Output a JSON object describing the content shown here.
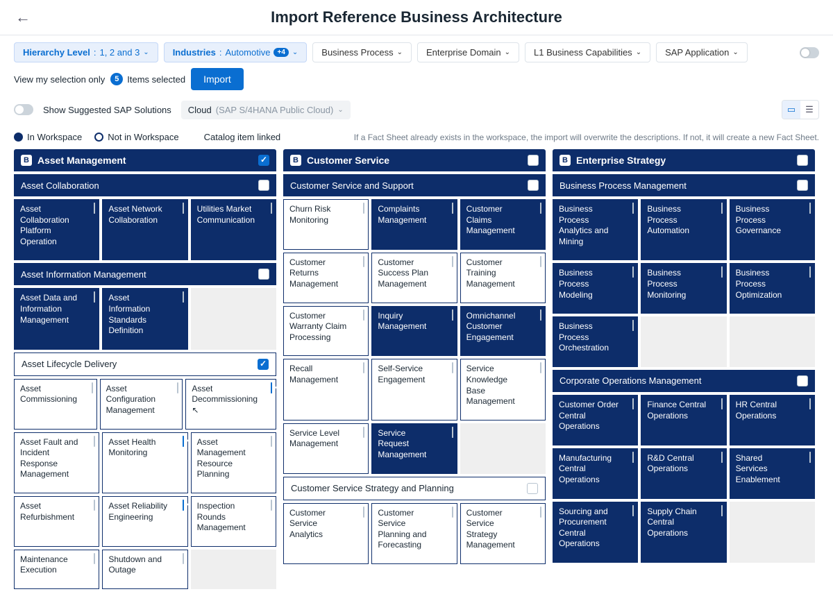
{
  "title": "Import Reference Business Architecture",
  "filters": {
    "hierarchy": {
      "label": "Hierarchy Level",
      "value": "1, 2 and 3"
    },
    "industries": {
      "label": "Industries",
      "value": "Automotive",
      "count": "+4"
    },
    "bp": "Business Process",
    "ed": "Enterprise Domain",
    "l1": "L1 Business Capabilities",
    "sap": "SAP Application",
    "viewSel": "View my selection only",
    "itemsSelected": "Items selected",
    "itemsCount": "5",
    "importBtn": "Import"
  },
  "subbar": {
    "suggest": "Show Suggested SAP Solutions",
    "cloudLabel": "Cloud",
    "cloudVal": "(SAP S/4HANA Public Cloud)"
  },
  "legend": {
    "inWs": "In Workspace",
    "notWs": "Not in Workspace",
    "catalog": "Catalog item linked",
    "hint": "If a Fact Sheet already exists in the workspace, the import will overwrite the descriptions. If not, it will create a new Fact Sheet."
  },
  "cols": [
    {
      "title": "Asset Management",
      "checked": true,
      "groups": [
        {
          "title": "Asset Collaboration",
          "dark": true,
          "items": [
            {
              "t": "Asset Collaboration Platform Operation",
              "dark": true
            },
            {
              "t": "Asset Network Collaboration",
              "dark": true
            },
            {
              "t": "Utilities Market Communication",
              "dark": true
            }
          ]
        },
        {
          "title": "Asset Information Management",
          "dark": true,
          "items": [
            {
              "t": "Asset Data and Information Management",
              "dark": true
            },
            {
              "t": "Asset Information Standards Definition",
              "dark": true
            },
            {
              "t": "",
              "placeholder": true
            }
          ]
        },
        {
          "title": "Asset Lifecycle Delivery",
          "dark": false,
          "checked": true,
          "items": [
            {
              "t": "Asset Commissioning"
            },
            {
              "t": "Asset Configuration Management"
            },
            {
              "t": "Asset Decommissioning",
              "checked": true,
              "cursor": true
            },
            {
              "t": "Asset Fault and Incident Response Management"
            },
            {
              "t": "Asset Health Monitoring",
              "checked": true
            },
            {
              "t": "Asset Management Resource Planning"
            },
            {
              "t": "Asset Refurbishment"
            },
            {
              "t": "Asset Reliability Engineering",
              "checked": true
            },
            {
              "t": "Inspection Rounds Management"
            },
            {
              "t": "Maintenance Execution",
              "nolink": true
            },
            {
              "t": "Shutdown and Outage",
              "nolink": true
            },
            {
              "t": "",
              "placeholder": true,
              "nolink": true
            }
          ]
        }
      ]
    },
    {
      "title": "Customer Service",
      "groups": [
        {
          "title": "Customer Service and Support",
          "dark": true,
          "items": [
            {
              "t": "Churn Risk Monitoring"
            },
            {
              "t": "Complaints Management",
              "dark": true
            },
            {
              "t": "Customer Claims Management",
              "dark": true
            },
            {
              "t": "Customer Returns Management"
            },
            {
              "t": "Customer Success Plan Management"
            },
            {
              "t": "Customer Training Management"
            },
            {
              "t": "Customer Warranty Claim Processing"
            },
            {
              "t": "Inquiry Management",
              "dark": true
            },
            {
              "t": "Omnichannel Customer Engagement",
              "dark": true
            },
            {
              "t": "Recall Management"
            },
            {
              "t": "Self-Service Engagement"
            },
            {
              "t": "Service Knowledge Base Management"
            },
            {
              "t": "Service Level Management"
            },
            {
              "t": "Service Request Management",
              "dark": true
            },
            {
              "t": "",
              "placeholder": true,
              "nolink": true
            }
          ]
        },
        {
          "title": "Customer Service Strategy and Planning",
          "dark": false,
          "items": [
            {
              "t": "Customer Service Analytics",
              "nolink": true
            },
            {
              "t": "Customer Service Planning and Forecasting",
              "nolink": true
            },
            {
              "t": "Customer Service Strategy Management",
              "nolink": true
            }
          ]
        }
      ]
    },
    {
      "title": "Enterprise Strategy",
      "groups": [
        {
          "title": "Business Process Management",
          "dark": true,
          "items": [
            {
              "t": "Business Process Analytics and Mining",
              "dark": true
            },
            {
              "t": "Business Process Automation",
              "dark": true
            },
            {
              "t": "Business Process Governance",
              "dark": true
            },
            {
              "t": "Business Process Modeling",
              "dark": true
            },
            {
              "t": "Business Process Monitoring",
              "dark": true
            },
            {
              "t": "Business Process Optimization",
              "dark": true
            },
            {
              "t": "Business Process Orchestration",
              "dark": true
            },
            {
              "t": "",
              "placeholder": true,
              "nolink": true
            },
            {
              "t": "",
              "placeholder": true,
              "nolink": true
            }
          ]
        },
        {
          "title": "Corporate Operations Management",
          "dark": true,
          "items": [
            {
              "t": "Customer Order Central Operations",
              "dark": true
            },
            {
              "t": "Finance Central Operations",
              "dark": true
            },
            {
              "t": "HR Central Operations",
              "dark": true
            },
            {
              "t": "Manufacturing Central Operations",
              "dark": true
            },
            {
              "t": "R&D Central Operations",
              "dark": true
            },
            {
              "t": "Shared Services Enablement",
              "dark": true
            },
            {
              "t": "Sourcing and Procurement Central Operations",
              "dark": true
            },
            {
              "t": "Supply Chain Central Operations",
              "dark": true
            },
            {
              "t": "",
              "placeholder": true,
              "nolink": true
            }
          ]
        }
      ]
    }
  ]
}
